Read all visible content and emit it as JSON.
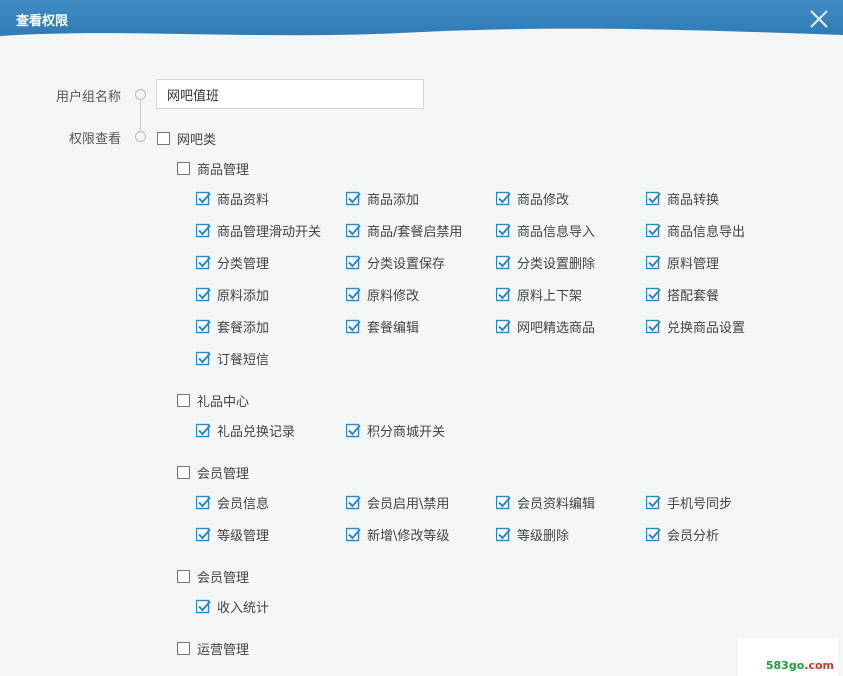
{
  "dialog": {
    "title": "查看权限"
  },
  "form": {
    "group_name_label": "用户组名称",
    "group_name_value": "网吧值班",
    "permission_label": "权限查看"
  },
  "root": {
    "label": "网吧类",
    "checked": false
  },
  "sections": [
    {
      "label": "商品管理",
      "checked": false,
      "items": [
        {
          "label": "商品资料",
          "checked": true
        },
        {
          "label": "商品添加",
          "checked": true
        },
        {
          "label": "商品修改",
          "checked": true
        },
        {
          "label": "商品转换",
          "checked": true
        },
        {
          "label": "商品管理滑动开关",
          "checked": true
        },
        {
          "label": "商品/套餐启禁用",
          "checked": true
        },
        {
          "label": "商品信息导入",
          "checked": true
        },
        {
          "label": "商品信息导出",
          "checked": true
        },
        {
          "label": "分类管理",
          "checked": true
        },
        {
          "label": "分类设置保存",
          "checked": true
        },
        {
          "label": "分类设置删除",
          "checked": true
        },
        {
          "label": "原料管理",
          "checked": true
        },
        {
          "label": "原料添加",
          "checked": true
        },
        {
          "label": "原料修改",
          "checked": true
        },
        {
          "label": "原料上下架",
          "checked": true
        },
        {
          "label": "搭配套餐",
          "checked": true
        },
        {
          "label": "套餐添加",
          "checked": true
        },
        {
          "label": "套餐编辑",
          "checked": true
        },
        {
          "label": "网吧精选商品",
          "checked": true
        },
        {
          "label": "兑换商品设置",
          "checked": true
        },
        {
          "label": "订餐短信",
          "checked": true
        }
      ]
    },
    {
      "label": "礼品中心",
      "checked": false,
      "items": [
        {
          "label": "礼品兑换记录",
          "checked": true
        },
        {
          "label": "积分商城开关",
          "checked": true
        }
      ]
    },
    {
      "label": "会员管理",
      "checked": false,
      "items": [
        {
          "label": "会员信息",
          "checked": true
        },
        {
          "label": "会员启用\\禁用",
          "checked": true
        },
        {
          "label": "会员资料编辑",
          "checked": true
        },
        {
          "label": "手机号同步",
          "checked": true
        },
        {
          "label": "等级管理",
          "checked": true
        },
        {
          "label": "新增\\修改等级",
          "checked": true
        },
        {
          "label": "等级删除",
          "checked": true
        },
        {
          "label": "会员分析",
          "checked": true
        }
      ]
    },
    {
      "label": "会员管理",
      "checked": false,
      "items": [
        {
          "label": "收入统计",
          "checked": true
        }
      ]
    },
    {
      "label": "运营管理",
      "checked": false,
      "items": []
    }
  ],
  "watermark": {
    "number": "583go",
    "domain": ".com"
  },
  "colors": {
    "titlebar": "#2f79b3",
    "check_accent": "#2b86c5",
    "background": "#f4f5f5"
  }
}
